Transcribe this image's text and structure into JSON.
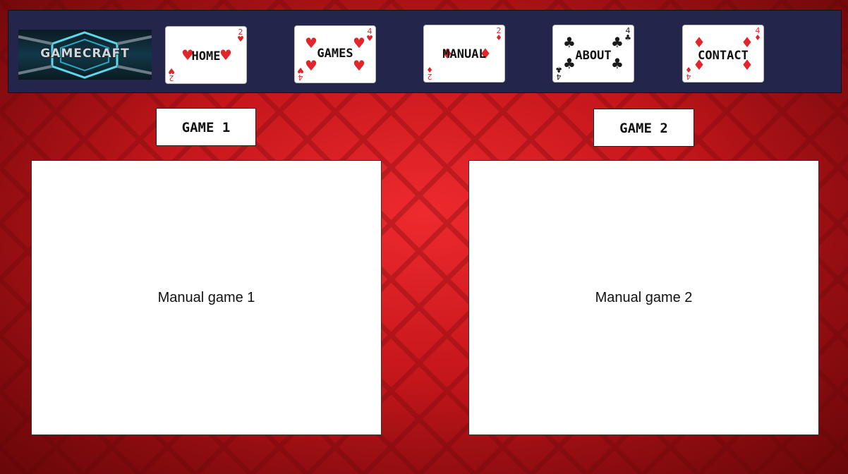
{
  "logo": {
    "text": "GAMECRAFT"
  },
  "nav": {
    "items": [
      {
        "label": "HOME",
        "rank": "2",
        "suit": "♥",
        "color": "red"
      },
      {
        "label": "GAMES",
        "rank": "4",
        "suit": "♥",
        "color": "red"
      },
      {
        "label": "MANUAL",
        "rank": "2",
        "suit": "♦",
        "color": "red"
      },
      {
        "label": "ABOUT",
        "rank": "4",
        "suit": "♣",
        "color": "black"
      },
      {
        "label": "CONTACT",
        "rank": "4",
        "suit": "♦",
        "color": "red"
      }
    ]
  },
  "games": [
    {
      "tab_label": "GAME 1",
      "panel_text": "Manual game 1"
    },
    {
      "tab_label": "GAME 2",
      "panel_text": "Manual game 2"
    }
  ],
  "colors": {
    "background": "#c4161b",
    "navbar": "#23264a",
    "suit_red": "#e0262b",
    "suit_black": "#1a1a1a"
  }
}
